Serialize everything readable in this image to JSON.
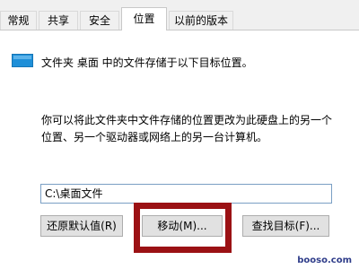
{
  "tabs": [
    {
      "label": "常规"
    },
    {
      "label": "共享"
    },
    {
      "label": "安全"
    },
    {
      "label": "位置"
    },
    {
      "label": "以前的版本"
    }
  ],
  "active_tab": "位置",
  "description": {
    "line1": "文件夹 桌面 中的文件存储于以下目标位置。",
    "line2": "你可以将此文件夹中文件存储的位置更改为此硬盘上的另一个",
    "line3": "位置、另一个驱动器或网络上的另一台计算机。"
  },
  "path_value": "C:\\桌面文件",
  "buttons": {
    "restore_default": "还原默认值(R)",
    "move": "移动(M)...",
    "find_target": "查找目标(F)..."
  },
  "watermark": "booso.com",
  "colors": {
    "highlight": "#9b1114",
    "folder_icon": "#1e8fd8"
  },
  "icons": {
    "folder": "folder-icon"
  }
}
